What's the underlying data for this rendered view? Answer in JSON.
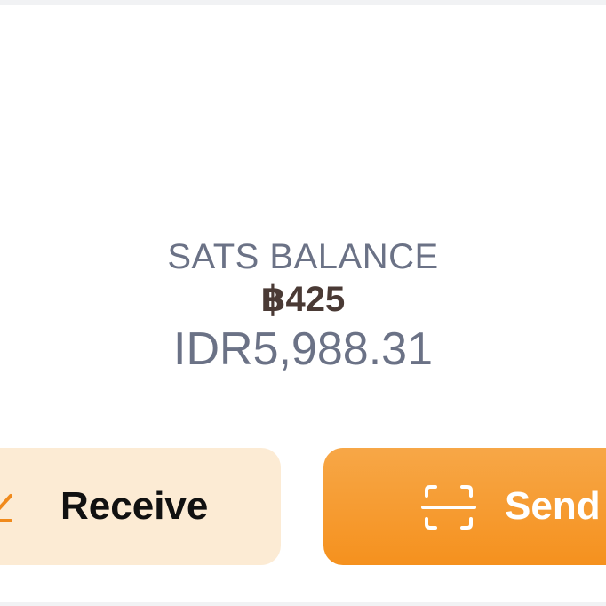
{
  "balance": {
    "label": "SATS BALANCE",
    "sats": "฿425",
    "fiat": "IDR5,988.31"
  },
  "actions": {
    "receive_label": "Receive",
    "send_label": "Send",
    "receive_icon": "arrow-down-left-icon",
    "send_icon": "scan-icon"
  },
  "colors": {
    "accent": "#f5911e",
    "receive_bg": "#fcebd4",
    "muted_text": "#6b7286",
    "sats_text": "#4a3a35"
  }
}
